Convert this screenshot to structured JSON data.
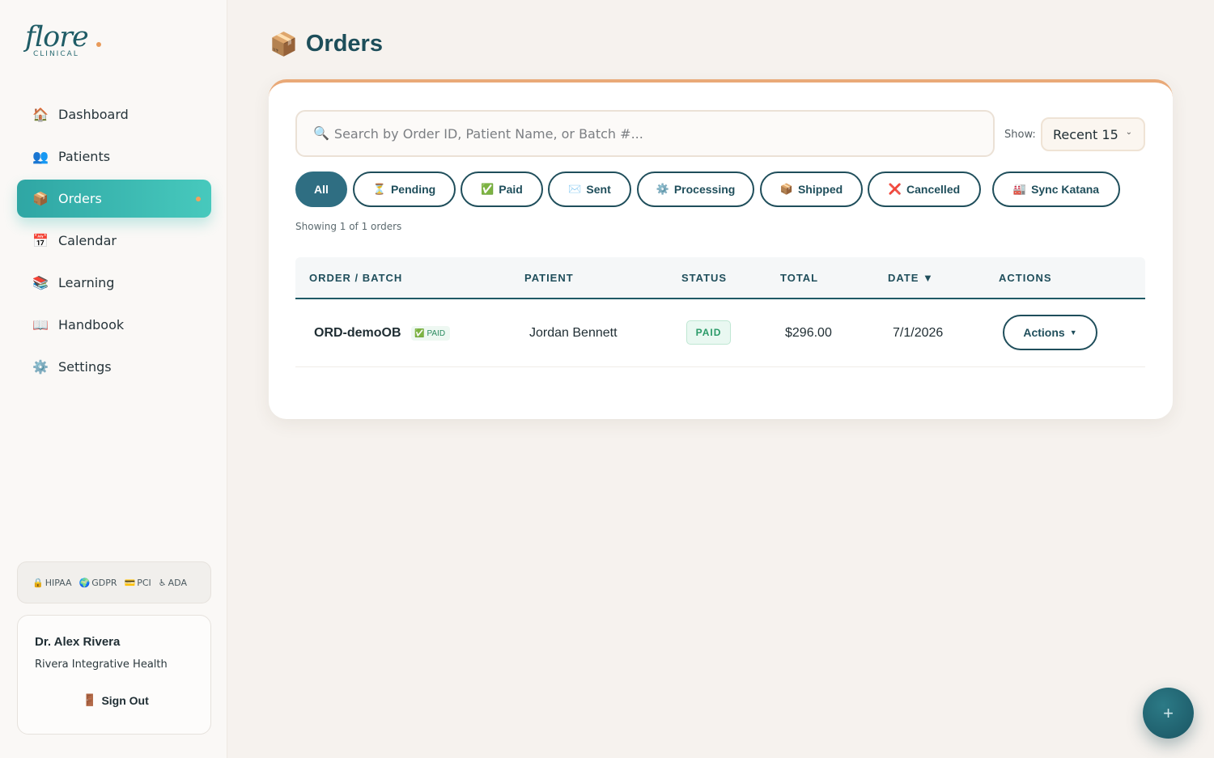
{
  "app": {
    "logo_main": "flore",
    "logo_sub": "CLINICAL",
    "accent_color": "#2fa6a4",
    "brand_color": "#1d4e5a"
  },
  "sidebar": {
    "items": [
      {
        "label": "Dashboard",
        "icon": "🏠",
        "icon_name": "house-icon"
      },
      {
        "label": "Patients",
        "icon": "👥",
        "icon_name": "users-icon"
      },
      {
        "label": "Orders",
        "icon": "📦",
        "icon_name": "package-icon",
        "active": true
      },
      {
        "label": "Calendar",
        "icon": "📅",
        "icon_name": "calendar-icon"
      },
      {
        "label": "Learning",
        "icon": "📚",
        "icon_name": "books-icon"
      },
      {
        "label": "Handbook",
        "icon": "📖",
        "icon_name": "book-icon"
      },
      {
        "label": "Settings",
        "icon": "⚙️",
        "icon_name": "gear-icon"
      }
    ],
    "compliance": [
      {
        "icon": "🔒",
        "label": "HIPAA"
      },
      {
        "icon": "🌍",
        "label": "GDPR"
      },
      {
        "icon": "💳",
        "label": "PCI"
      },
      {
        "icon": "♿",
        "label": "ADA"
      }
    ],
    "user": {
      "name": "Dr. Alex Rivera",
      "org": "Rivera Integrative Health",
      "signout_icon": "🚪",
      "signout_label": "Sign Out"
    }
  },
  "page": {
    "title_icon": "📦",
    "title": "Orders"
  },
  "search": {
    "icon": "🔍",
    "placeholder": "Search by Order ID, Patient Name, or Batch #..."
  },
  "show": {
    "label": "Show:",
    "selected": "Recent 15",
    "chevron": "⌄"
  },
  "filters": [
    {
      "label": "All",
      "icon": "",
      "active": true
    },
    {
      "label": "Pending",
      "icon": "⏳"
    },
    {
      "label": "Paid",
      "icon": "✅"
    },
    {
      "label": "Sent",
      "icon": "✉️"
    },
    {
      "label": "Processing",
      "icon": "⚙️"
    },
    {
      "label": "Shipped",
      "icon": "📦"
    },
    {
      "label": "Cancelled",
      "icon": "❌"
    },
    {
      "label": "Sync Katana",
      "icon": "🏭"
    }
  ],
  "showing_text": "Showing 1 of 1 orders",
  "table": {
    "headers": [
      "ORDER / BATCH",
      "PATIENT",
      "STATUS",
      "TOTAL",
      "DATE ▼",
      "ACTIONS"
    ],
    "rows": [
      {
        "order_id": "ORD-demoOB",
        "mini_badge_icon": "✅",
        "mini_badge": "PAID",
        "patient": "Jordan Bennett",
        "status": "PAID",
        "total": "$296.00",
        "date": "7/1/2026",
        "actions_label": "Actions",
        "actions_caret": "▼"
      }
    ]
  },
  "fab": {
    "label": "+"
  }
}
